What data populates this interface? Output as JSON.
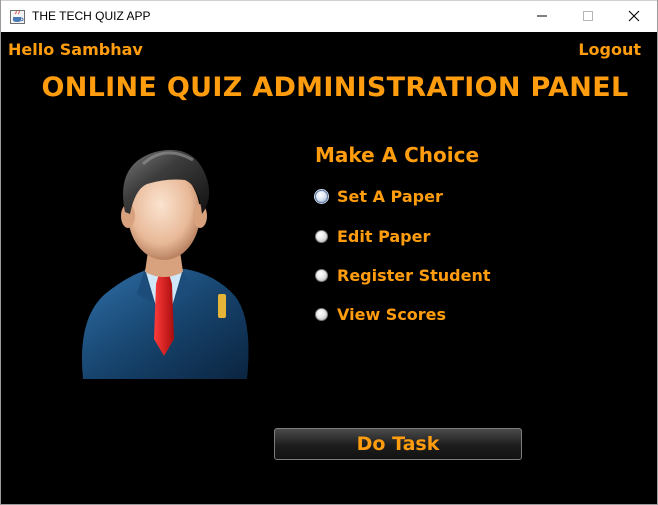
{
  "window": {
    "title": "THE TECH QUIZ APP",
    "app_icon": "java-app-icon",
    "controls": [
      "minimize-icon",
      "maximize-icon",
      "close-icon"
    ]
  },
  "header": {
    "greeting": "Hello Sambhav",
    "logout_label": "Logout"
  },
  "panel_title": "ONLINE QUIZ ADMINISTRATION PANEL",
  "avatar_icon": "admin-user-avatar",
  "choice": {
    "heading": "Make A Choice",
    "options": [
      {
        "label": "Set A Paper",
        "selected": true
      },
      {
        "label": "Edit Paper",
        "selected": false
      },
      {
        "label": "Register Student",
        "selected": false
      },
      {
        "label": "View Scores",
        "selected": false
      }
    ]
  },
  "action_button_label": "Do Task",
  "colors": {
    "accent": "#ff9d0f",
    "background": "#000000"
  }
}
